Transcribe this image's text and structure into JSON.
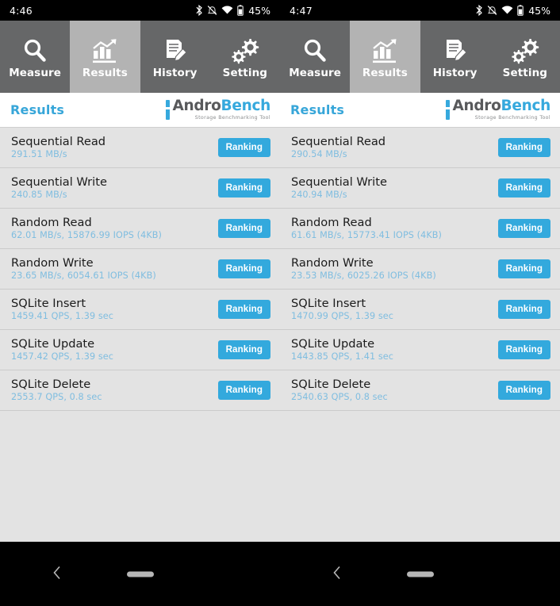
{
  "theme": {
    "accent_blue": "#33a9dd",
    "value_blue": "#7fbde0",
    "tab_bg": "#666768",
    "tab_selected_bg": "#b3b3b3",
    "content_bg": "#e3e3e3",
    "header_bg": "#ffffff"
  },
  "panels": [
    {
      "statusbar": {
        "time": "4:46",
        "battery_percent": "45%",
        "icons": [
          "bluetooth-icon",
          "notifications-muted-icon",
          "wifi-icon",
          "battery-icon"
        ]
      },
      "tabs": [
        {
          "label": "Measure",
          "icon": "magnifier-icon",
          "selected": false
        },
        {
          "label": "Results",
          "icon": "bar-chart-icon",
          "selected": true
        },
        {
          "label": "History",
          "icon": "document-pen-icon",
          "selected": false
        },
        {
          "label": "Setting",
          "icon": "gears-icon",
          "selected": false
        }
      ],
      "header": {
        "title": "Results",
        "logo_primary": "Andro",
        "logo_secondary": "Bench",
        "logo_subtitle": "Storage Benchmarking Tool"
      },
      "results": [
        {
          "title": "Sequential Read",
          "value": "291.51 MB/s",
          "button": "Ranking"
        },
        {
          "title": "Sequential Write",
          "value": "240.85 MB/s",
          "button": "Ranking"
        },
        {
          "title": "Random Read",
          "value": "62.01 MB/s, 15876.99 IOPS (4KB)",
          "button": "Ranking"
        },
        {
          "title": "Random Write",
          "value": "23.65 MB/s, 6054.61 IOPS (4KB)",
          "button": "Ranking"
        },
        {
          "title": "SQLite Insert",
          "value": "1459.41 QPS, 1.39 sec",
          "button": "Ranking"
        },
        {
          "title": "SQLite Update",
          "value": "1457.42 QPS, 1.39 sec",
          "button": "Ranking"
        },
        {
          "title": "SQLite Delete",
          "value": "2553.7 QPS, 0.8 sec",
          "button": "Ranking"
        }
      ],
      "navbar": {
        "back": "back-chevron-icon",
        "home": "home-pill-icon"
      }
    },
    {
      "statusbar": {
        "time": "4:47",
        "battery_percent": "45%",
        "icons": [
          "bluetooth-icon",
          "notifications-muted-icon",
          "wifi-icon",
          "battery-icon"
        ]
      },
      "tabs": [
        {
          "label": "Measure",
          "icon": "magnifier-icon",
          "selected": false
        },
        {
          "label": "Results",
          "icon": "bar-chart-icon",
          "selected": true
        },
        {
          "label": "History",
          "icon": "document-pen-icon",
          "selected": false
        },
        {
          "label": "Setting",
          "icon": "gears-icon",
          "selected": false
        }
      ],
      "header": {
        "title": "Results",
        "logo_primary": "Andro",
        "logo_secondary": "Bench",
        "logo_subtitle": "Storage Benchmarking Tool"
      },
      "results": [
        {
          "title": "Sequential Read",
          "value": "290.54 MB/s",
          "button": "Ranking"
        },
        {
          "title": "Sequential Write",
          "value": "240.94 MB/s",
          "button": "Ranking"
        },
        {
          "title": "Random Read",
          "value": "61.61 MB/s, 15773.41 IOPS (4KB)",
          "button": "Ranking"
        },
        {
          "title": "Random Write",
          "value": "23.53 MB/s, 6025.26 IOPS (4KB)",
          "button": "Ranking"
        },
        {
          "title": "SQLite Insert",
          "value": "1470.99 QPS, 1.39 sec",
          "button": "Ranking"
        },
        {
          "title": "SQLite Update",
          "value": "1443.85 QPS, 1.41 sec",
          "button": "Ranking"
        },
        {
          "title": "SQLite Delete",
          "value": "2540.63 QPS, 0.8 sec",
          "button": "Ranking"
        }
      ],
      "navbar": {
        "back": "back-chevron-icon",
        "home": "home-pill-icon"
      }
    }
  ]
}
